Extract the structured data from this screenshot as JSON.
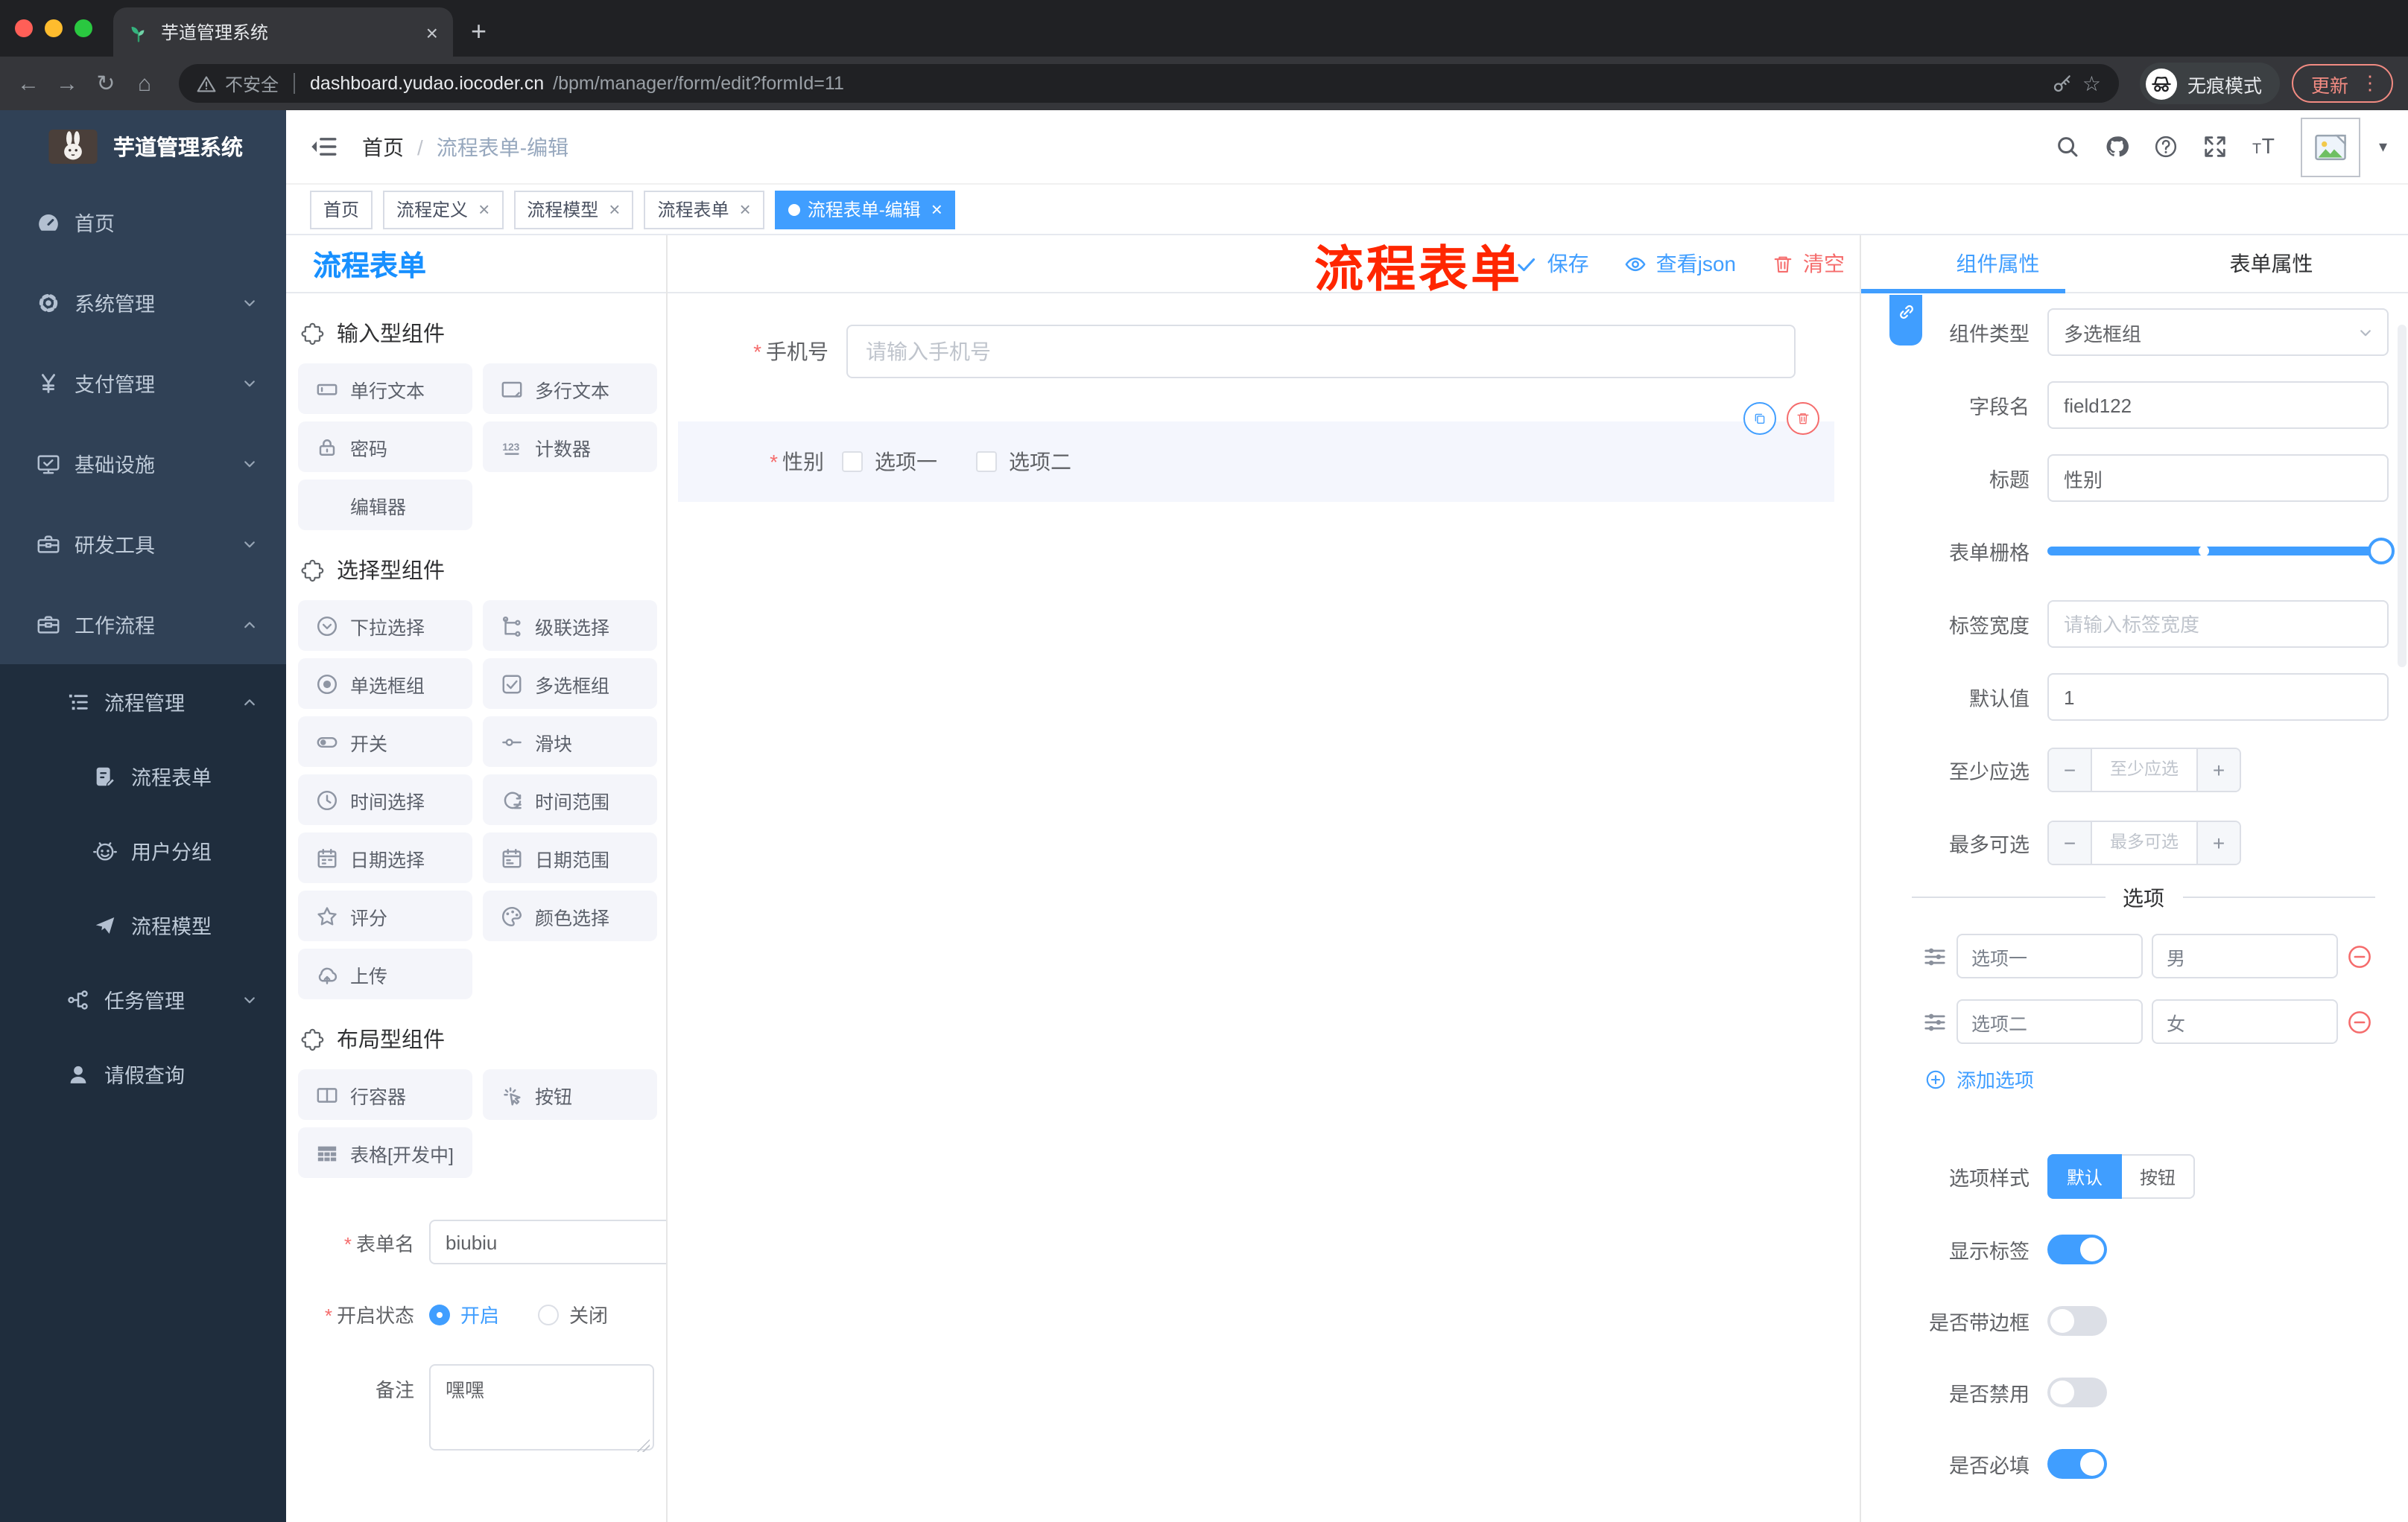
{
  "browser": {
    "tab_title": "芋道管理系统",
    "security_label": "不安全",
    "url_domain": "dashboard.yudao.iocoder.cn",
    "url_path": "/bpm/manager/form/edit?formId=11",
    "incognito_label": "无痕模式",
    "update_label": "更新"
  },
  "sidebar": {
    "logo_title": "芋道管理系统",
    "menu": [
      {
        "label": "首页",
        "icon": "dashboard",
        "level": 1,
        "chevron": "",
        "zone": "light"
      },
      {
        "label": "系统管理",
        "icon": "gear",
        "level": 1,
        "chevron": "down",
        "zone": "light"
      },
      {
        "label": "支付管理",
        "icon": "yen",
        "level": 1,
        "chevron": "down",
        "zone": "light"
      },
      {
        "label": "基础设施",
        "icon": "monitor",
        "level": 1,
        "chevron": "down",
        "zone": "light"
      },
      {
        "label": "研发工具",
        "icon": "toolbox",
        "level": 1,
        "chevron": "down",
        "zone": "light"
      },
      {
        "label": "工作流程",
        "icon": "briefcase",
        "level": 1,
        "chevron": "up",
        "zone": "light"
      },
      {
        "label": "流程管理",
        "icon": "flow-list",
        "level": 2,
        "chevron": "up",
        "zone": "dark"
      },
      {
        "label": "流程表单",
        "icon": "doc-edit",
        "level": 3,
        "chevron": "",
        "zone": "dark"
      },
      {
        "label": "用户分组",
        "icon": "robot",
        "level": 3,
        "chevron": "",
        "zone": "dark"
      },
      {
        "label": "流程模型",
        "icon": "paper-plane",
        "level": 3,
        "chevron": "",
        "zone": "dark"
      },
      {
        "label": "任务管理",
        "icon": "branch",
        "level": 2,
        "chevron": "down",
        "zone": "dark"
      },
      {
        "label": "请假查询",
        "icon": "user",
        "level": 2,
        "chevron": "",
        "zone": "dark"
      }
    ]
  },
  "navbar": {
    "breadcrumb": {
      "home": "首页",
      "current": "流程表单-编辑"
    },
    "annotation": "流程表单"
  },
  "tags": [
    {
      "label": "首页",
      "closable": false,
      "active": false
    },
    {
      "label": "流程定义",
      "closable": true,
      "active": false
    },
    {
      "label": "流程模型",
      "closable": true,
      "active": false
    },
    {
      "label": "流程表单",
      "closable": true,
      "active": false
    },
    {
      "label": "流程表单-编辑",
      "closable": true,
      "active": true
    }
  ],
  "designer": {
    "panel_title": "流程表单",
    "toolbar": {
      "save": "保存",
      "view_json": "查看json",
      "clear": "清空"
    },
    "palette": [
      {
        "heading": "输入型组件",
        "items": [
          {
            "label": "单行文本",
            "icon": "input"
          },
          {
            "label": "多行文本",
            "icon": "textarea"
          },
          {
            "label": "密码",
            "icon": "lock"
          },
          {
            "label": "计数器",
            "icon": "counter"
          },
          {
            "label": "编辑器",
            "icon": "none"
          }
        ]
      },
      {
        "heading": "选择型组件",
        "items": [
          {
            "label": "下拉选择",
            "icon": "select"
          },
          {
            "label": "级联选择",
            "icon": "cascader"
          },
          {
            "label": "单选框组",
            "icon": "radio"
          },
          {
            "label": "多选框组",
            "icon": "checkbox"
          },
          {
            "label": "开关",
            "icon": "switch"
          },
          {
            "label": "滑块",
            "icon": "slider"
          },
          {
            "label": "时间选择",
            "icon": "time"
          },
          {
            "label": "时间范围",
            "icon": "time-range"
          },
          {
            "label": "日期选择",
            "icon": "date"
          },
          {
            "label": "日期范围",
            "icon": "date-range"
          },
          {
            "label": "评分",
            "icon": "star"
          },
          {
            "label": "颜色选择",
            "icon": "color"
          },
          {
            "label": "上传",
            "icon": "upload"
          }
        ]
      },
      {
        "heading": "布局型组件",
        "items": [
          {
            "label": "行容器",
            "icon": "row"
          },
          {
            "label": "按钮",
            "icon": "click"
          },
          {
            "label": "表格[开发中]",
            "icon": "table"
          }
        ]
      }
    ],
    "meta_form": {
      "name_label": "表单名",
      "name_value": "biubiu",
      "status_label": "开启状态",
      "status_on": "开启",
      "status_off": "关闭",
      "remark_label": "备注",
      "remark_value": "嘿嘿"
    },
    "canvas": {
      "phone": {
        "label": "手机号",
        "placeholder": "请输入手机号"
      },
      "gender": {
        "label": "性别",
        "options": [
          "选项一",
          "选项二"
        ]
      }
    }
  },
  "inspector": {
    "tabs": [
      "组件属性",
      "表单属性"
    ],
    "rows": {
      "component_type": {
        "label": "组件类型",
        "value": "多选框组"
      },
      "field_name": {
        "label": "字段名",
        "value": "field122"
      },
      "title": {
        "label": "标题",
        "value": "性别"
      },
      "grid": {
        "label": "表单栅格"
      },
      "label_width": {
        "label": "标签宽度",
        "placeholder": "请输入标签宽度"
      },
      "default_value": {
        "label": "默认值",
        "value": "1"
      },
      "min_select": {
        "label": "至少应选",
        "placeholder": "至少应选"
      },
      "max_select": {
        "label": "最多可选",
        "placeholder": "最多可选"
      }
    },
    "options_section": {
      "divider": "选项",
      "options": [
        {
          "label": "选项一",
          "value": "男"
        },
        {
          "label": "选项二",
          "value": "女"
        }
      ],
      "add_label": "添加选项"
    },
    "style_row": {
      "label": "选项样式",
      "options": [
        "默认",
        "按钮"
      ],
      "selected": "默认"
    },
    "switches": [
      {
        "label": "显示标签",
        "on": true
      },
      {
        "label": "是否带边框",
        "on": false
      },
      {
        "label": "是否禁用",
        "on": false
      },
      {
        "label": "是否必填",
        "on": true
      }
    ]
  },
  "colors": {
    "primary": "#409eff",
    "danger": "#f56c6c",
    "annotation": "#ff2600",
    "sidebar_bg": "#304156",
    "submenu_bg": "#1f2d3d"
  },
  "glyphs": {
    "close": "×",
    "check": "✓",
    "dots": "⋮",
    "caret": "▾",
    "plus": "+",
    "minus": "−",
    "slash": "/",
    "asterisk": "*",
    "back": "←",
    "forward": "→",
    "reload": "↻",
    "home": "⌂",
    "star": "☆"
  }
}
